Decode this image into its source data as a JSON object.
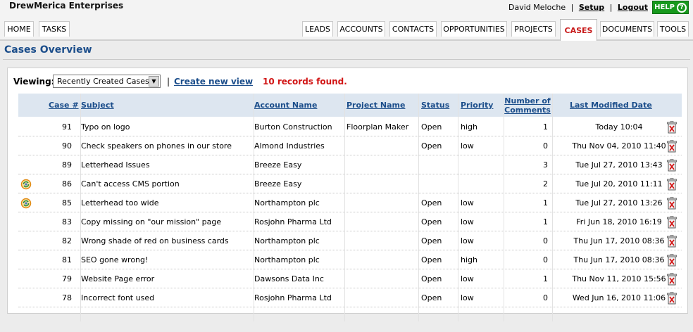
{
  "company": "DrewMerica Enterprises",
  "user": {
    "name": "David Meloche",
    "setup": "Setup",
    "logout": "Logout",
    "help": "HELP",
    "sep": "|"
  },
  "tabs_left": [
    {
      "label": "HOME"
    },
    {
      "label": "TASKS"
    }
  ],
  "tabs_right": [
    {
      "label": "LEADS"
    },
    {
      "label": "ACCOUNTS"
    },
    {
      "label": "CONTACTS"
    },
    {
      "label": "OPPORTUNITIES"
    },
    {
      "label": "PROJECTS"
    },
    {
      "label": "CASES",
      "active": true
    },
    {
      "label": "DOCUMENTS"
    },
    {
      "label": "TOOLS"
    }
  ],
  "page_title": "Cases Overview",
  "toolbar": {
    "viewing_label": "Viewing:",
    "view_selected": "Recently Created Cases",
    "pipe": "|",
    "create_view": "Create new view",
    "records_found": "10 records found."
  },
  "columns": {
    "case": "Case #",
    "subject": "Subject",
    "account": "Account Name",
    "project": "Project Name",
    "status": "Status",
    "priority": "Priority",
    "comments_1": "Number of",
    "comments_2": "Comments",
    "modified": "Last Modified Date"
  },
  "rows": [
    {
      "case": "91",
      "subject": "Typo on logo",
      "account": "Burton Construction",
      "project": "Floorplan Maker",
      "status": "Open",
      "priority": "high",
      "comments": "1",
      "modified": "Today 10:04",
      "sync": false
    },
    {
      "case": "90",
      "subject": "Check speakers on phones in our store",
      "account": "Almond Industries",
      "project": "",
      "status": "Open",
      "priority": "low",
      "comments": "0",
      "modified": "Thu Nov 04, 2010 11:40",
      "sync": false
    },
    {
      "case": "89",
      "subject": "Letterhead Issues",
      "account": "Breeze Easy",
      "project": "",
      "status": "",
      "priority": "",
      "comments": "3",
      "modified": "Tue Jul 27, 2010 13:43",
      "sync": false
    },
    {
      "case": "86",
      "subject": "Can't access CMS portion",
      "account": "Breeze Easy",
      "project": "",
      "status": "",
      "priority": "",
      "comments": "2",
      "modified": "Tue Jul 20, 2010 11:11",
      "sync": true
    },
    {
      "case": "85",
      "subject": "Letterhead too wide",
      "account": "Northampton plc",
      "project": "",
      "status": "Open",
      "priority": "low",
      "comments": "1",
      "modified": "Tue Jul 27, 2010 13:26",
      "sync": true
    },
    {
      "case": "83",
      "subject": "Copy missing on \"our mission\" page",
      "account": "Rosjohn Pharma Ltd",
      "project": "",
      "status": "Open",
      "priority": "low",
      "comments": "1",
      "modified": "Fri Jun 18, 2010 16:19",
      "sync": false
    },
    {
      "case": "82",
      "subject": "Wrong shade of red on business cards",
      "account": "Northampton plc",
      "project": "",
      "status": "Open",
      "priority": "low",
      "comments": "0",
      "modified": "Thu Jun 17, 2010 08:36",
      "sync": false
    },
    {
      "case": "81",
      "subject": "SEO gone wrong!",
      "account": "Northampton plc",
      "project": "",
      "status": "Open",
      "priority": "high",
      "comments": "0",
      "modified": "Thu Jun 17, 2010 08:36",
      "sync": false
    },
    {
      "case": "79",
      "subject": "Website Page error",
      "account": "Dawsons Data Inc",
      "project": "",
      "status": "Open",
      "priority": "low",
      "comments": "1",
      "modified": "Thu Nov 11, 2010 15:56",
      "sync": false
    },
    {
      "case": "78",
      "subject": "Incorrect font used",
      "account": "Rosjohn Pharma Ltd",
      "project": "",
      "status": "Open",
      "priority": "low",
      "comments": "0",
      "modified": "Wed Jun 16, 2010 11:06",
      "sync": false
    }
  ],
  "colors": {
    "link": "#1c4e8b",
    "active_tab": "#c81b1b",
    "records": "#d11515",
    "help_bg": "#17991d",
    "header_bg": "#dde6f0"
  }
}
